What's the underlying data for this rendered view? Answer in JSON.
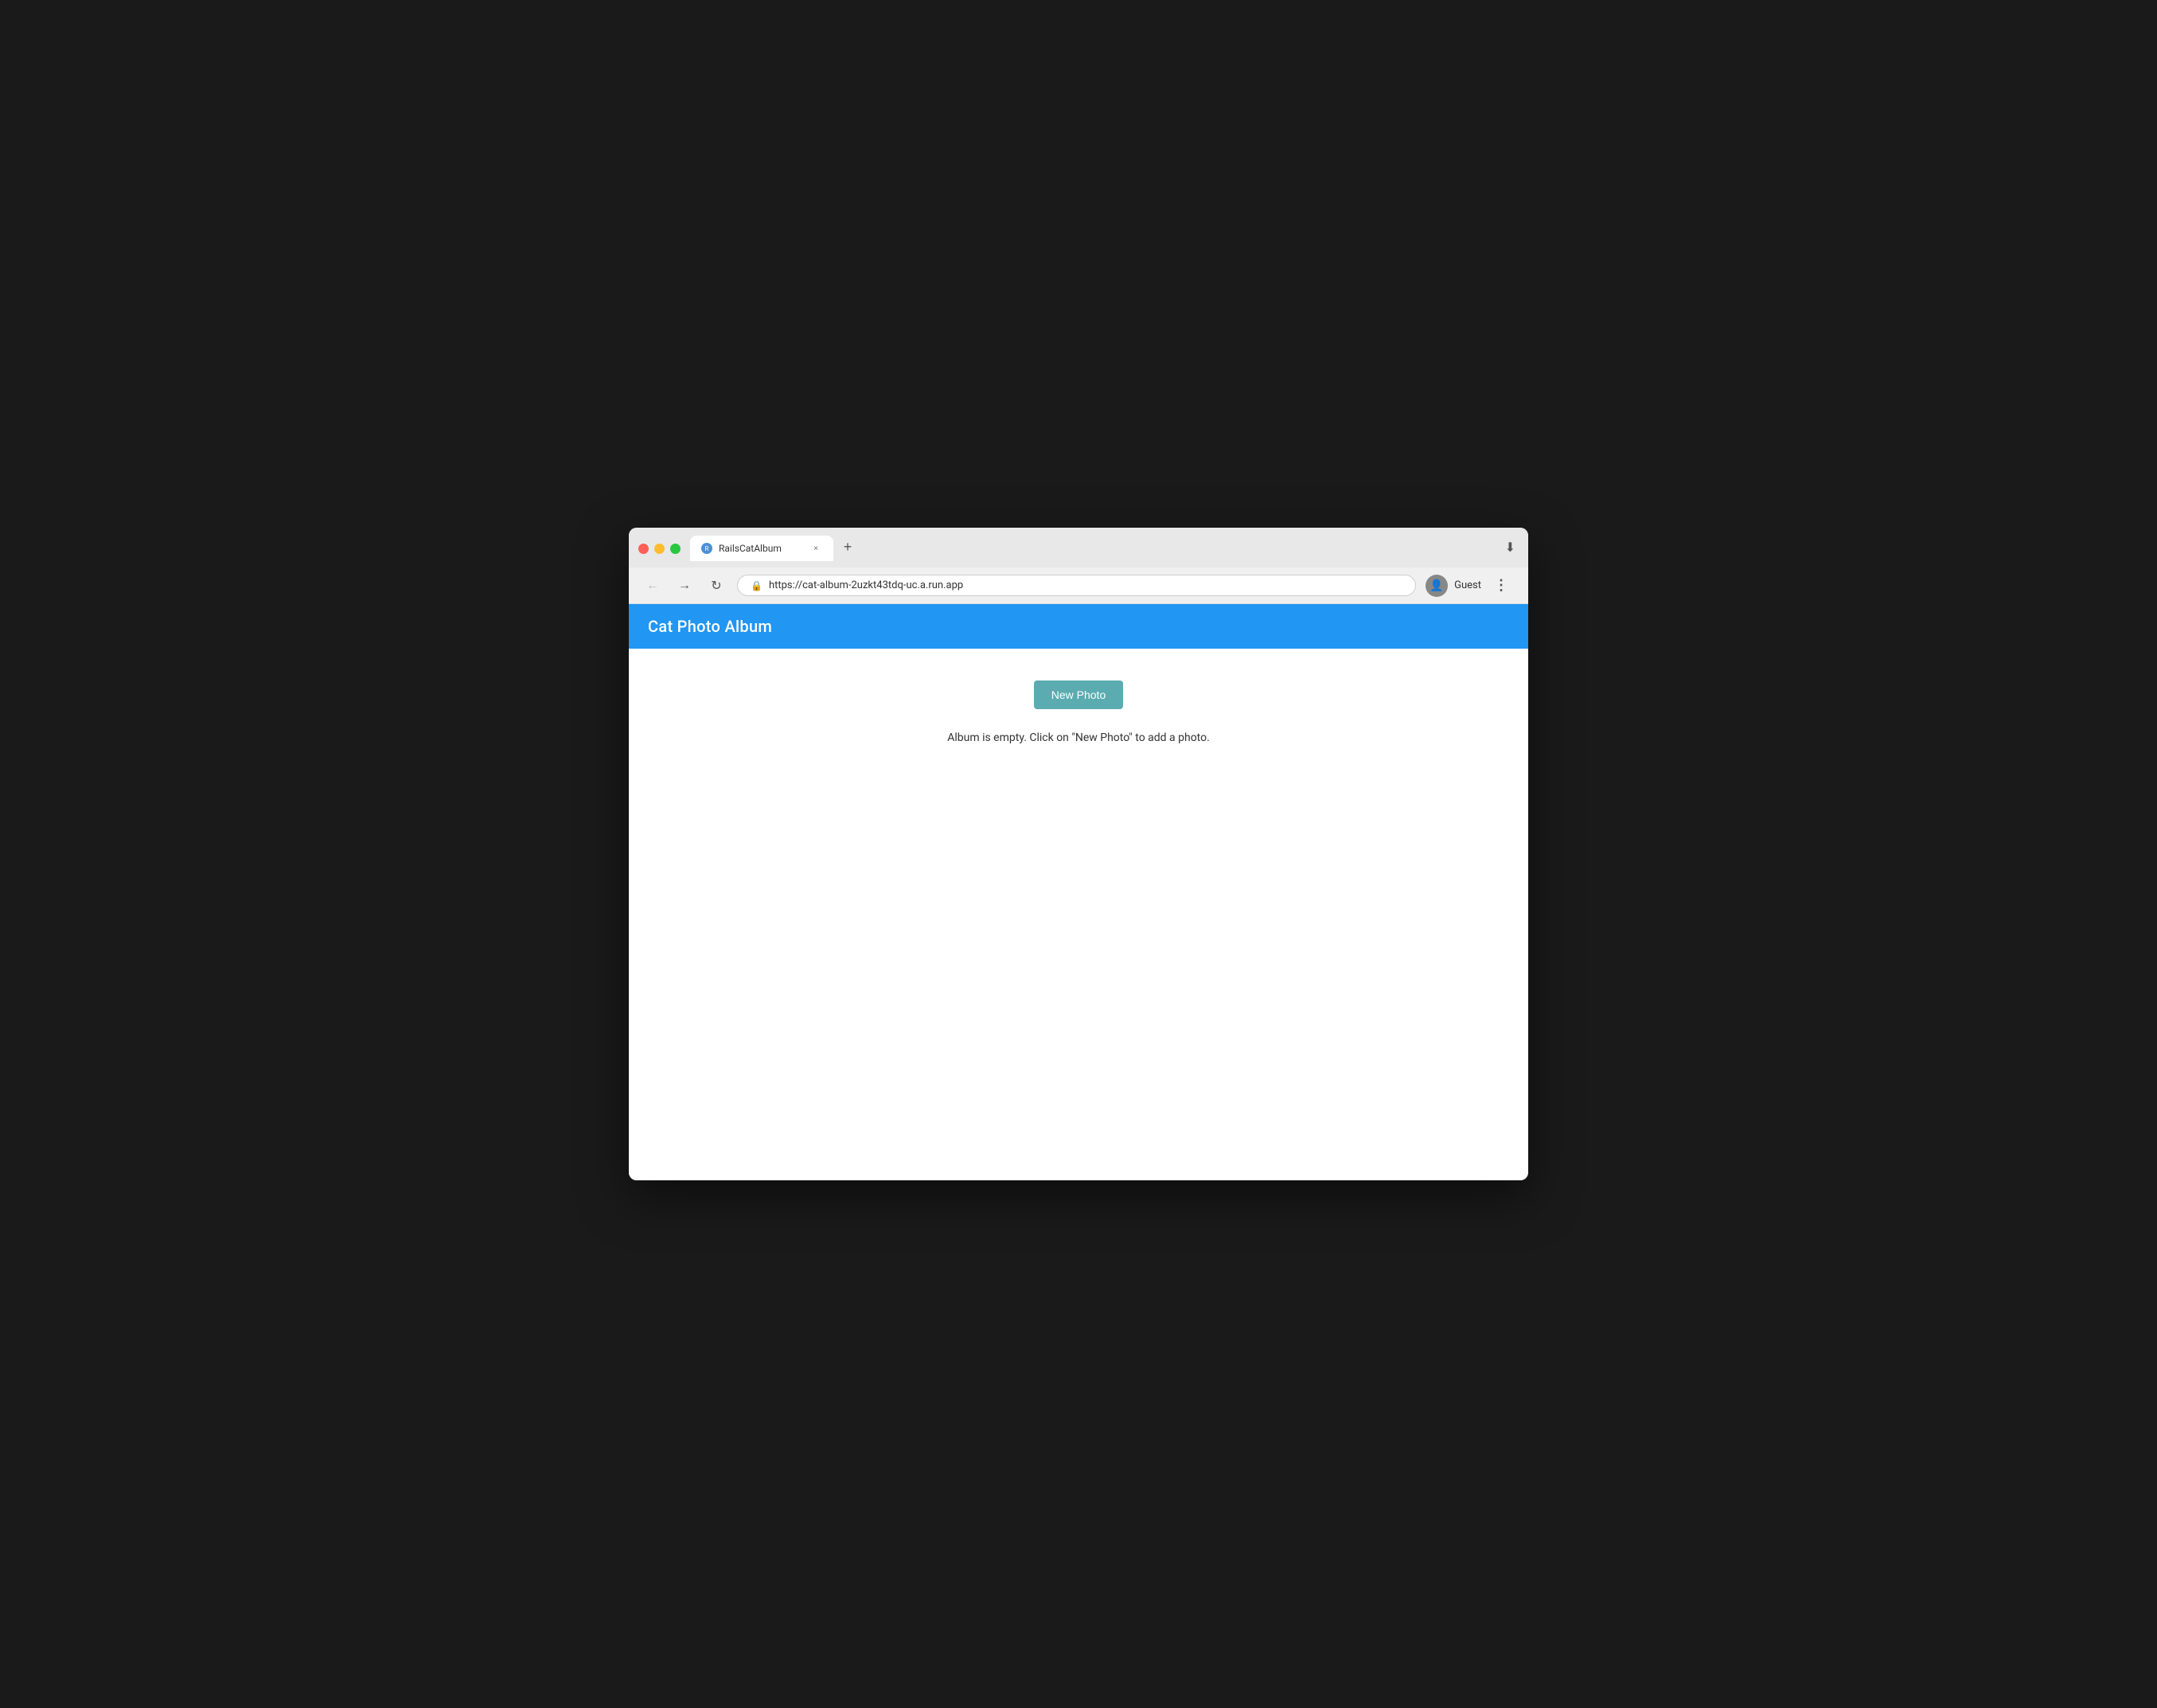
{
  "browser": {
    "tab": {
      "favicon_label": "R",
      "title": "RailsCatAlbum",
      "close_label": "×"
    },
    "tab_new_label": "+",
    "nav": {
      "back_label": "←",
      "forward_label": "→",
      "reload_label": "↻"
    },
    "address": {
      "lock_icon": "🔒",
      "url": "https://cat-album-2uzkt43tdq-uc.a.run.app"
    },
    "user": {
      "icon_label": "👤",
      "guest_label": "Guest"
    },
    "more_label": "⋮",
    "download_icon": "⬇"
  },
  "app": {
    "header": {
      "title": "Cat Photo Album"
    },
    "main": {
      "new_photo_btn": "New Photo",
      "empty_message": "Album is empty. Click on \"New Photo\" to add a photo."
    }
  }
}
